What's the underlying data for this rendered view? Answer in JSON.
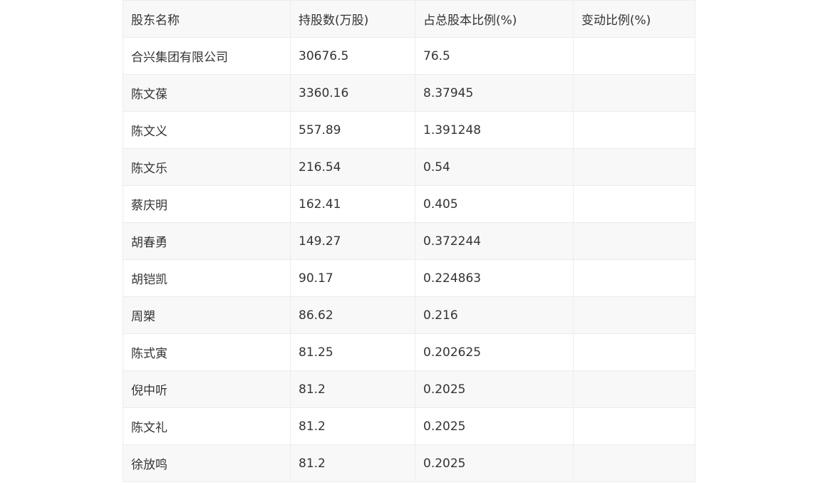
{
  "table": {
    "headers": [
      "股东名称",
      "持股数(万股)",
      "占总股本比例(%)",
      "变动比例(%)"
    ],
    "rows": [
      [
        "合兴集团有限公司",
        "30676.5",
        "76.5",
        ""
      ],
      [
        "陈文葆",
        "3360.16",
        "8.37945",
        ""
      ],
      [
        "陈文义",
        "557.89",
        "1.391248",
        ""
      ],
      [
        "陈文乐",
        "216.54",
        "0.54",
        ""
      ],
      [
        "蔡庆明",
        "162.41",
        "0.405",
        ""
      ],
      [
        "胡春勇",
        "149.27",
        "0.372244",
        ""
      ],
      [
        "胡铠凯",
        "90.17",
        "0.224863",
        ""
      ],
      [
        "周槊",
        "86.62",
        "0.216",
        ""
      ],
      [
        "陈式寅",
        "81.25",
        "0.202625",
        ""
      ],
      [
        "倪中听",
        "81.2",
        "0.2025",
        ""
      ],
      [
        "陈文礼",
        "81.2",
        "0.2025",
        ""
      ],
      [
        "徐放鸣",
        "81.2",
        "0.2025",
        ""
      ]
    ]
  }
}
